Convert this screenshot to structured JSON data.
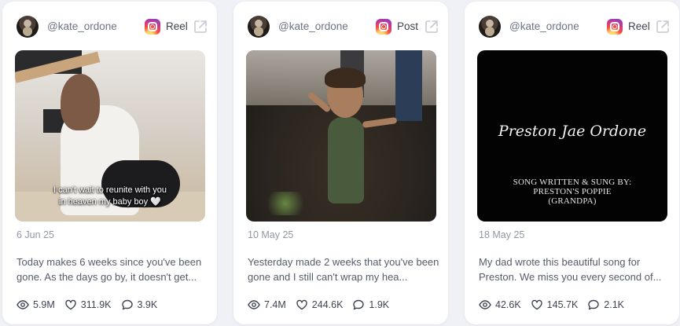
{
  "cards": [
    {
      "handle": "@kate_ordone",
      "type": "Reel",
      "media_caption_line1": "I can't wait to reunite with you",
      "media_caption_line2": "in heaven my baby boy 🤍",
      "date": "6 Jun 25",
      "caption": "Today makes 6 weeks since you've been gone. As the days go by, it doesn't get...",
      "views": "5.9M",
      "likes": "311.9K",
      "comments": "3.9K"
    },
    {
      "handle": "@kate_ordone",
      "type": "Post",
      "date": "10 May 25",
      "caption": "Yesterday made 2 weeks that you've been gone and I still can't wrap my hea...",
      "views": "7.4M",
      "likes": "244.6K",
      "comments": "1.9K"
    },
    {
      "handle": "@kate_ordone",
      "type": "Reel",
      "media_title": "Preston Jae Ordone",
      "media_credit_line1": "SONG WRITTEN & SUNG BY:",
      "media_credit_line2": "PRESTON'S POPPIE",
      "media_credit_line3": "(GRANDPA)",
      "date": "18 May 25",
      "caption": "My dad wrote this beautiful song for Preston. We miss you every second of...",
      "views": "42.6K",
      "likes": "145.7K",
      "comments": "2.1K"
    }
  ],
  "colors": {
    "background": "#eff1f6",
    "card": "#ffffff",
    "muted_text": "#6b7385",
    "date_text": "#9097a6"
  },
  "icons": [
    "instagram-icon",
    "external-link-icon",
    "eye-icon",
    "heart-icon",
    "comment-icon"
  ]
}
